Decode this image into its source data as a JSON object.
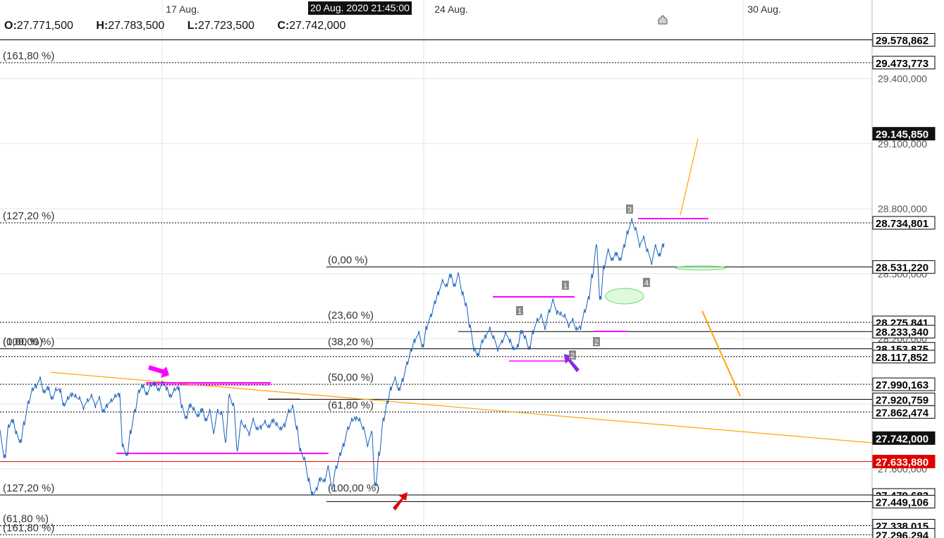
{
  "ohlc": {
    "open_label": "O:",
    "open": "27.771,500",
    "high_label": "H:",
    "high": "27.783,500",
    "low_label": "L:",
    "low": "27.723,500",
    "close_label": "C:",
    "close": "27.742,000"
  },
  "crosshair_date": "20 Aug. 2020 21:45:00",
  "colors": {
    "price": "#1560bd",
    "magenta": "#ff00ff",
    "orange": "#ffa500",
    "green": "#90ee90",
    "red": "#e00000",
    "purple": "#8a2be2",
    "grid": "#e6e6e6"
  },
  "chart_data": {
    "type": "line",
    "instrument_series": "price",
    "x_ticks": [
      "17 Aug.",
      "24 Aug.",
      "30 Aug."
    ],
    "ylim": [
      27250,
      29650
    ],
    "y_ticks": [
      "29.400,000",
      "29.100,000",
      "28.800,000",
      "28.500,000",
      "28.200,000",
      "27.900,000",
      "27.600,000"
    ],
    "price_labels": [
      {
        "value": 29578.862,
        "text": "29.578,862",
        "style": "light"
      },
      {
        "value": 29473.773,
        "text": "29.473,773",
        "style": "light"
      },
      {
        "value": 29145.85,
        "text": "29.145,850",
        "style": "dark"
      },
      {
        "value": 28734.801,
        "text": "28.734,801",
        "style": "light"
      },
      {
        "value": 28531.22,
        "text": "28.531,220",
        "style": "light"
      },
      {
        "value": 28275.841,
        "text": "28.275,841",
        "style": "light"
      },
      {
        "value": 28233.34,
        "text": "28.233,340",
        "style": "light"
      },
      {
        "value": 28153.875,
        "text": "28.153,875",
        "style": "light"
      },
      {
        "value": 28117.852,
        "text": "28.117,852",
        "style": "light"
      },
      {
        "value": 27990.163,
        "text": "27.990,163",
        "style": "light"
      },
      {
        "value": 27920.759,
        "text": "27.920,759",
        "style": "light"
      },
      {
        "value": 27862.474,
        "text": "27.862,474",
        "style": "light"
      },
      {
        "value": 27742.0,
        "text": "27.742,000",
        "style": "dark"
      },
      {
        "value": 27633.88,
        "text": "27.633,880",
        "style": "red"
      },
      {
        "value": 27479.683,
        "text": "27.479,683",
        "style": "light"
      },
      {
        "value": 27449.106,
        "text": "27.449,106",
        "style": "light"
      },
      {
        "value": 27338.015,
        "text": "27.338,015",
        "style": "light"
      },
      {
        "value": 27296.294,
        "text": "27.296,294",
        "style": "light"
      }
    ],
    "fib_labels": [
      {
        "value": 29473.773,
        "text": "(161,80 %)",
        "side": "left"
      },
      {
        "value": 28734.801,
        "text": "(127,20 %)",
        "side": "left"
      },
      {
        "value": 28531.22,
        "text": "(0,00 %)",
        "side": "mid"
      },
      {
        "value": 28275.841,
        "text": "(23,60 %)",
        "side": "mid"
      },
      {
        "value": 28153.875,
        "text": "(38,20 %)",
        "side": "mid"
      },
      {
        "value": 27990.163,
        "text": "(50,00 %)",
        "side": "mid"
      },
      {
        "value": 27862.474,
        "text": "(61,80 %)",
        "side": "mid"
      },
      {
        "value": 27479.683,
        "text": "(100,00 %)",
        "side": "mid"
      },
      {
        "value": 27479.683,
        "text": "(127,20 %)",
        "side": "left"
      },
      {
        "value": 27338.015,
        "text": "(61,80 %)",
        "side": "left"
      },
      {
        "value": 27296.294,
        "text": "(161,80 %)",
        "side": "left"
      },
      {
        "value": 28153.875,
        "text": "(100,00 %)",
        "side": "left"
      },
      {
        "value": 28153.875,
        "text": "(0,00 %)",
        "side": "left"
      }
    ],
    "wave_labels": [
      "1",
      "1",
      "2",
      "2",
      "3",
      "4"
    ],
    "series": [
      {
        "values": [
          [
            0,
            27780
          ],
          [
            1,
            27650
          ],
          [
            2,
            27790
          ],
          [
            3,
            27830
          ],
          [
            4,
            27760
          ],
          [
            5,
            27720
          ],
          [
            6,
            27820
          ],
          [
            7,
            27900
          ],
          [
            8,
            27960
          ],
          [
            9,
            27990
          ],
          [
            10,
            28010
          ],
          [
            11,
            27950
          ],
          [
            12,
            27980
          ],
          [
            13,
            27920
          ],
          [
            14,
            27960
          ],
          [
            15,
            27970
          ],
          [
            16,
            27890
          ],
          [
            17,
            27920
          ],
          [
            18,
            27950
          ],
          [
            19,
            27930
          ],
          [
            20,
            27920
          ],
          [
            21,
            27890
          ],
          [
            22,
            27910
          ],
          [
            23,
            27930
          ],
          [
            24,
            27900
          ],
          [
            25,
            27920
          ],
          [
            26,
            27860
          ],
          [
            27,
            27900
          ],
          [
            28,
            27910
          ],
          [
            29,
            27930
          ],
          [
            30,
            27950
          ],
          [
            31,
            27700
          ],
          [
            32,
            27660
          ],
          [
            33,
            27780
          ],
          [
            34,
            27860
          ],
          [
            35,
            27950
          ],
          [
            36,
            27990
          ],
          [
            37,
            27940
          ],
          [
            38,
            27980
          ],
          [
            39,
            28000
          ],
          [
            40,
            27960
          ],
          [
            41,
            27990
          ],
          [
            42,
            27980
          ],
          [
            43,
            27930
          ],
          [
            44,
            27960
          ],
          [
            45,
            27980
          ],
          [
            46,
            27880
          ],
          [
            47,
            27830
          ],
          [
            48,
            27900
          ],
          [
            49,
            27870
          ],
          [
            50,
            27840
          ],
          [
            51,
            27880
          ],
          [
            52,
            27820
          ],
          [
            53,
            27860
          ],
          [
            54,
            27780
          ],
          [
            55,
            27860
          ],
          [
            56,
            27850
          ],
          [
            57,
            27740
          ],
          [
            58,
            27930
          ],
          [
            59,
            27890
          ],
          [
            60,
            27700
          ],
          [
            61,
            27810
          ],
          [
            62,
            27790
          ],
          [
            63,
            27770
          ],
          [
            64,
            27820
          ],
          [
            65,
            27780
          ],
          [
            66,
            27800
          ],
          [
            67,
            27810
          ],
          [
            68,
            27790
          ],
          [
            69,
            27830
          ],
          [
            70,
            27800
          ],
          [
            71,
            27780
          ],
          [
            72,
            27810
          ],
          [
            73,
            27860
          ],
          [
            74,
            27880
          ],
          [
            75,
            27800
          ],
          [
            76,
            27680
          ],
          [
            77,
            27640
          ],
          [
            78,
            27560
          ],
          [
            79,
            27480
          ],
          [
            80,
            27500
          ],
          [
            81,
            27560
          ],
          [
            82,
            27540
          ],
          [
            83,
            27600
          ],
          [
            84,
            27520
          ],
          [
            85,
            27600
          ],
          [
            86,
            27660
          ],
          [
            87,
            27720
          ],
          [
            88,
            27780
          ],
          [
            89,
            27820
          ],
          [
            90,
            27840
          ],
          [
            91,
            27820
          ],
          [
            92,
            27780
          ],
          [
            93,
            27720
          ],
          [
            94,
            27760
          ],
          [
            95,
            27520
          ],
          [
            96,
            27680
          ],
          [
            97,
            27820
          ],
          [
            98,
            27900
          ],
          [
            99,
            27980
          ],
          [
            100,
            28010
          ],
          [
            101,
            27960
          ],
          [
            102,
            28020
          ],
          [
            103,
            28080
          ],
          [
            104,
            28140
          ],
          [
            105,
            28200
          ],
          [
            106,
            28220
          ],
          [
            107,
            28160
          ],
          [
            108,
            28260
          ],
          [
            109,
            28300
          ],
          [
            110,
            28360
          ],
          [
            111,
            28420
          ],
          [
            112,
            28460
          ],
          [
            113,
            28440
          ],
          [
            114,
            28500
          ],
          [
            115,
            28440
          ],
          [
            116,
            28490
          ],
          [
            117,
            28420
          ],
          [
            118,
            28350
          ],
          [
            119,
            28250
          ],
          [
            120,
            28160
          ],
          [
            121,
            28120
          ],
          [
            122,
            28180
          ],
          [
            123,
            28220
          ],
          [
            124,
            28240
          ],
          [
            125,
            28200
          ],
          [
            126,
            28160
          ],
          [
            127,
            28180
          ],
          [
            128,
            28220
          ],
          [
            129,
            28200
          ],
          [
            130,
            28150
          ],
          [
            131,
            28160
          ],
          [
            132,
            28240
          ],
          [
            133,
            28200
          ],
          [
            134,
            28150
          ],
          [
            135,
            28240
          ],
          [
            136,
            28280
          ],
          [
            137,
            28300
          ],
          [
            138,
            28260
          ],
          [
            139,
            28320
          ],
          [
            140,
            28370
          ],
          [
            141,
            28330
          ],
          [
            142,
            28310
          ],
          [
            143,
            28300
          ],
          [
            144,
            28270
          ],
          [
            145,
            28280
          ],
          [
            146,
            28240
          ],
          [
            147,
            28260
          ],
          [
            148,
            28320
          ],
          [
            149,
            28380
          ],
          [
            150,
            28500
          ],
          [
            151,
            28620
          ],
          [
            152,
            28380
          ],
          [
            153,
            28540
          ],
          [
            154,
            28600
          ],
          [
            155,
            28560
          ],
          [
            156,
            28600
          ],
          [
            157,
            28560
          ],
          [
            158,
            28620
          ],
          [
            159,
            28700
          ],
          [
            160,
            28740
          ],
          [
            161,
            28700
          ],
          [
            162,
            28640
          ],
          [
            163,
            28660
          ],
          [
            164,
            28600
          ],
          [
            165,
            28560
          ],
          [
            166,
            28620
          ],
          [
            167,
            28580
          ],
          [
            168,
            28640
          ]
        ]
      }
    ]
  }
}
